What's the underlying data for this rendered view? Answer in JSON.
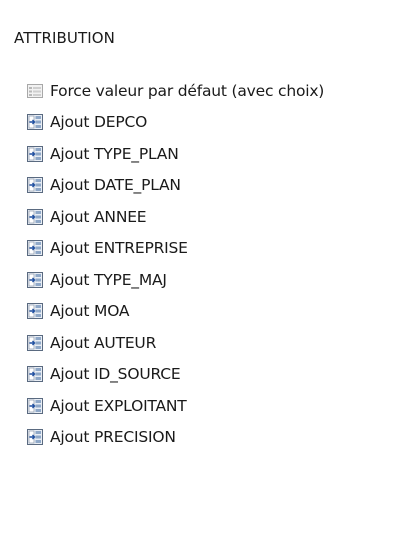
{
  "section": {
    "title": "ATTRIBUTION"
  },
  "items": [
    {
      "label": "Force valeur par défaut (avec choix)",
      "icon": "default-value-icon"
    },
    {
      "label": "Ajout DEPCO",
      "icon": "add-field-icon"
    },
    {
      "label": "Ajout TYPE_PLAN",
      "icon": "add-field-icon"
    },
    {
      "label": "Ajout DATE_PLAN",
      "icon": "add-field-icon"
    },
    {
      "label": "Ajout ANNEE",
      "icon": "add-field-icon"
    },
    {
      "label": "Ajout ENTREPRISE",
      "icon": "add-field-icon"
    },
    {
      "label": "Ajout TYPE_MAJ",
      "icon": "add-field-icon"
    },
    {
      "label": "Ajout MOA",
      "icon": "add-field-icon"
    },
    {
      "label": "Ajout AUTEUR",
      "icon": "add-field-icon"
    },
    {
      "label": "Ajout ID_SOURCE",
      "icon": "add-field-icon"
    },
    {
      "label": "Ajout EXPLOITANT",
      "icon": "add-field-icon"
    },
    {
      "label": "Ajout PRECISION",
      "icon": "add-field-icon"
    }
  ]
}
